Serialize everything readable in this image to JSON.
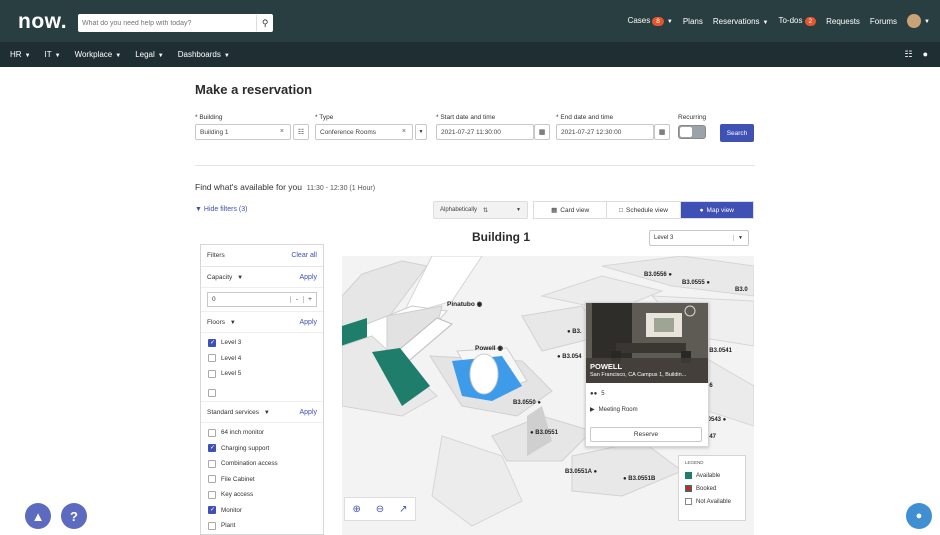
{
  "header": {
    "logo": "now.",
    "search_placeholder": "What do you need help with today?",
    "nav": [
      {
        "label": "Cases",
        "badge": "8"
      },
      {
        "label": "Plans"
      },
      {
        "label": "Reservations"
      },
      {
        "label": "To-dos",
        "badge": "2"
      },
      {
        "label": "Requests"
      },
      {
        "label": "Forums"
      }
    ]
  },
  "subnav": [
    "HR",
    "IT",
    "Workplace",
    "Legal",
    "Dashboards"
  ],
  "page": {
    "title": "Make a reservation",
    "form": {
      "building_label": "* Building",
      "building_value": "Building 1",
      "type_label": "* Type",
      "type_value": "Conference Rooms",
      "start_label": "* Start date and time",
      "start_value": "2021-07-27 11:30:00",
      "end_label": "* End date and time",
      "end_value": "2021-07-27 12:30:00",
      "recurring_label": "Recurring",
      "search_button": "Search"
    },
    "find_label": "Find what's available for you",
    "find_time": "11:30 - 12:30 (1 Hour)",
    "hide_filters": "Hide filters (3)",
    "sort_value": "Alphabetically",
    "views": [
      "Card view",
      "Schedule view",
      "Map view"
    ],
    "active_view": "Map view",
    "building_title": "Building 1",
    "level_value": "Level 3"
  },
  "filters": {
    "title": "Filters",
    "clear_all": "Clear all",
    "capacity_label": "Capacity",
    "apply": "Apply",
    "capacity_value": "0",
    "floors_label": "Floors",
    "floors": [
      {
        "label": "Level 3",
        "checked": true
      },
      {
        "label": "Level 4",
        "checked": false
      },
      {
        "label": "Level 5",
        "checked": false
      },
      {
        "label": "",
        "checked": false
      }
    ],
    "services_label": "Standard services",
    "services": [
      {
        "label": "64 inch monitor",
        "checked": false
      },
      {
        "label": "Charging support",
        "checked": true
      },
      {
        "label": "Combination access",
        "checked": false
      },
      {
        "label": "File Cabinet",
        "checked": false
      },
      {
        "label": "Key access",
        "checked": false
      },
      {
        "label": "Monitor",
        "checked": true
      },
      {
        "label": "Plant",
        "checked": false
      }
    ]
  },
  "map": {
    "rooms": [
      "B3.0556",
      "B3.0555",
      "B3.0",
      "Pinatubo",
      "Powell",
      "B3.",
      "B3.054",
      "B3.0541",
      "B3.0550",
      "B3.0551",
      "B3.0551A",
      "B3.0551B",
      "46",
      ".0543",
      "547"
    ],
    "popup": {
      "name": "POWELL",
      "location": "San Francisco, CA Campus 1, Buildin...",
      "capacity": "5",
      "room_type": "Meeting Room",
      "reserve": "Reserve"
    },
    "legend": {
      "title": "LEGEND",
      "items": [
        {
          "label": "Available",
          "color": "#1e7d6b"
        },
        {
          "label": "Booked",
          "color": "#c62828"
        },
        {
          "label": "Not Available",
          "color": "#ffffff"
        }
      ]
    }
  },
  "colors": {
    "topbar": "#293e40",
    "primary": "#3f51b5",
    "available": "#1e7d6b",
    "selected_room": "#3d9be9"
  }
}
